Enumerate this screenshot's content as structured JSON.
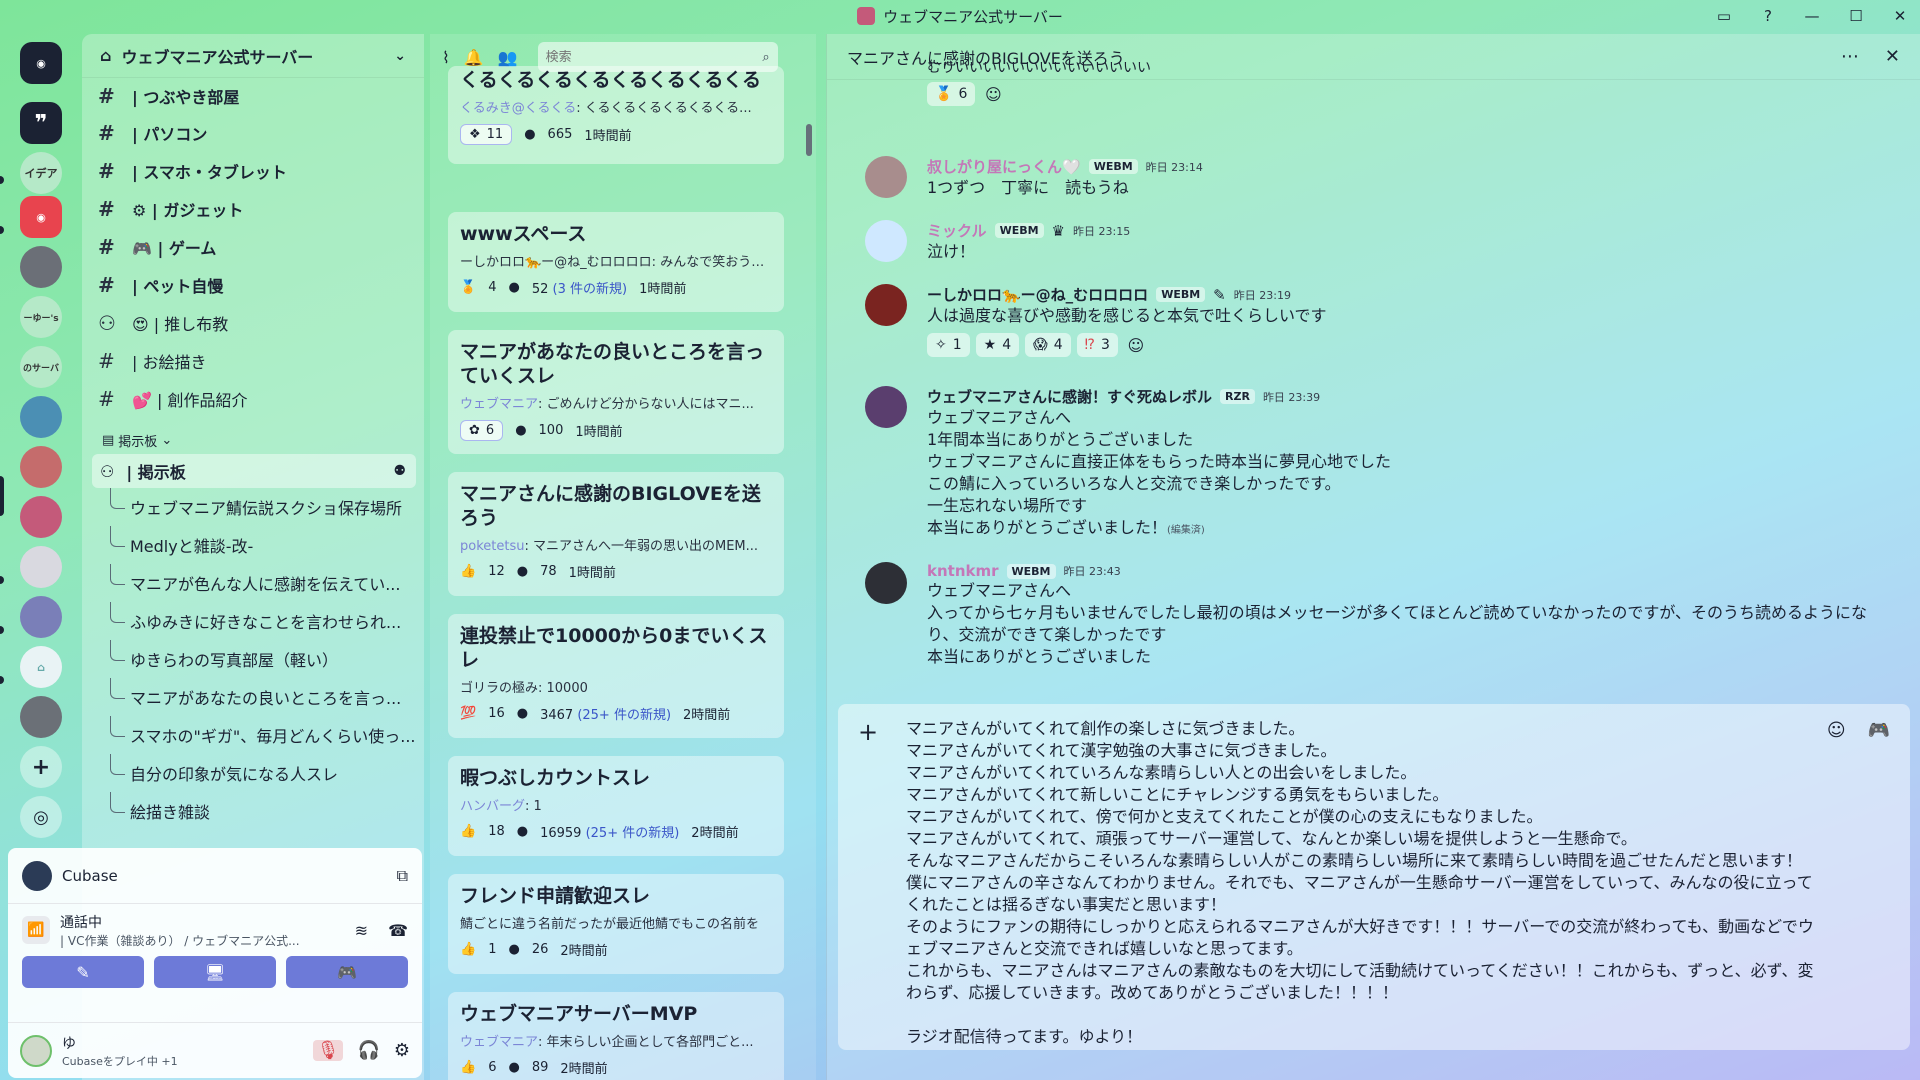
{
  "window": {
    "title": "ウェブマニア公式サーバー"
  },
  "server": {
    "name": "ウェブマニア公式サーバー"
  },
  "rail": {
    "labels": [
      "イデア",
      "ーゆー's",
      "のサーバ"
    ]
  },
  "channels": [
    {
      "label": "| つぶやき部屋",
      "color": "#f0a24a"
    },
    {
      "label": "| パソコン",
      "color": "#5aa6e8"
    },
    {
      "label": "| スマホ・タブレット",
      "color": "#555"
    },
    {
      "label": "⚙ | ガジェット",
      "color": ""
    },
    {
      "label": "🎮 | ゲーム",
      "color": ""
    },
    {
      "label": "| ペット自慢",
      "color": "#d9a45a"
    },
    {
      "label": "😍 | 推し布教",
      "color": ""
    },
    {
      "label": "| お絵描き",
      "color": "#f2a9c4"
    },
    {
      "label": "💕 | 創作品紹介",
      "color": ""
    }
  ],
  "category": {
    "label": "掲示板"
  },
  "forum_channel": {
    "label": "| 掲示板"
  },
  "threads": [
    "ウェブマニア鯖伝説スクショ保存場所",
    "Medlyと雑談-改-",
    "マニアが色んな人に感謝を伝えてい...",
    "ふゆみきに好きなことを言わせられ...",
    "ゆきらわの写真部屋（軽い）",
    "マニアがあなたの良いところを言っ...",
    "スマホの\"ギガ\"、毎月どんくらい使っ...",
    "自分の印象が気になる人スレ",
    "絵描き雑談"
  ],
  "voice": {
    "activity": "Cubase",
    "status": "通話中",
    "channel": "| VC作業（雑談あり） / ウェブマニア公式...",
    "btn1": "✎",
    "btn2": "🖥",
    "btn3": "🎮"
  },
  "user": {
    "name": "ゆ",
    "status": "Cubaseをプレイ中 +1"
  },
  "forum_list": {
    "search_placeholder": "検索",
    "posts": [
      {
        "title": "くるくるくるくるくるくるくるくる",
        "author": "くるみき@くるくる",
        "preview": ": くるくるくるくるくるくる...",
        "react_count": "11",
        "replies": "665",
        "new": "",
        "time": "1時間前"
      },
      {
        "title": "wwwスペース",
        "author": "",
        "preview": "ーしかロロ🐆ー@ね_むロロロロ: みんなで笑おう！...",
        "react_count": "4",
        "replies": "52",
        "new": "(3 件の新規)",
        "time": "1時間前"
      },
      {
        "title": "マニアがあなたの良いところを言っていくスレ",
        "author": "ウェブマニア",
        "preview": ": ごめんけど分からない人にはマニ...",
        "react_count": "6",
        "replies": "100",
        "new": "",
        "time": "1時間前"
      },
      {
        "title": "マニアさんに感謝のBIGLOVEを送ろう",
        "author": "poketetsu",
        "preview": ": マニアさんへ一年弱の思い出のMEM...",
        "react_count": "12",
        "replies": "78",
        "new": "",
        "time": "1時間前"
      },
      {
        "title": "連投禁止で10000から0までいくスレ",
        "author": "",
        "preview": "ゴリラの極み: 10000",
        "react_count": "16",
        "replies": "3467",
        "new": "(25+ 件の新規)",
        "time": "2時間前"
      },
      {
        "title": "暇つぶしカウントスレ",
        "author": "ハンバーグ",
        "preview": ": 1",
        "react_count": "18",
        "replies": "16959",
        "new": "(25+ 件の新規)",
        "time": "2時間前"
      },
      {
        "title": "フレンド申請歓迎スレ",
        "author": "",
        "preview": "鯖ごとに違う名前だったが最近他鯖でもこの名前を",
        "react_count": "1",
        "replies": "26",
        "new": "",
        "time": "2時間前"
      },
      {
        "title": "ウェブマニアサーバーMVP",
        "author": "ウェブマニア",
        "preview": ": 年末らしい企画として各部門ごと...",
        "react_count": "6",
        "replies": "89",
        "new": "",
        "time": "2時間前"
      }
    ]
  },
  "thread_panel": {
    "title": "マニアさんに感謝のBIGLOVEを送ろう",
    "top_partial": "むりいいいいいいいいいいいいいい",
    "top_react_count": "6",
    "messages": [
      {
        "name": "叔しがり屋にっくん🤍",
        "tag": "WEBM",
        "time": "昨日 23:14",
        "lines": [
          "1つずつ　丁寧に　読もうね"
        ]
      },
      {
        "name": "ミックル",
        "tag": "WEBM",
        "time": "昨日 23:15",
        "lines": [
          "泣け！"
        ]
      },
      {
        "name": "ーしかロロ🐆ー@ね_むロロロロ",
        "tag": "WEBM",
        "time": "昨日 23:19",
        "lines": [
          "人は過度な喜びや感動を感じると本気で吐くらしいです"
        ],
        "reactions": [
          "1",
          "4",
          "4",
          "3"
        ]
      },
      {
        "name": "ウェブマニアさんに感謝！すぐ死ぬレボル",
        "tag": "RZR",
        "time": "昨日 23:39",
        "lines": [
          "ウェブマニアさんへ",
          "1年間本当にありがとうございました",
          "ウェブマニアさんに直接正体をもらった時本当に夢見心地でした",
          "この鯖に入っていろいろな人と交流でき楽しかったです。",
          "一生忘れない場所です",
          "本当にありがとうございました！"
        ],
        "edited": "(編集済)"
      },
      {
        "name": "kntnkmr",
        "tag": "WEBM",
        "time": "昨日 23:43",
        "lines": [
          "ウェブマニアさんへ",
          "入ってから七ヶ月もいませんでしたし最初の頃はメッセージが多くてほとんど読めていなかったのですが、そのうち読めるようにな",
          "り、交流ができて楽しかったです",
          "本当にありがとうございました"
        ]
      }
    ]
  },
  "composer": {
    "text": "マニアさんがいてくれて創作の楽しさに気づきました。\nマニアさんがいてくれて漢字勉強の大事さに気づきました。\nマニアさんがいてくれていろんな素晴らしい人との出会いをしました。\nマニアさんがいてくれて新しいことにチャレンジする勇気をもらいました。\nマニアさんがいてくれて、傍で何かと支えてくれたことが僕の心の支えにもなりました。\nマニアさんがいてくれて、頑張ってサーバー運営して、なんとか楽しい場を提供しようと一生懸命で。\nそんなマニアさんだからこそいろんな素晴らしい人がこの素晴らしい場所に来て素晴らしい時間を過ごせたんだと思います！\n僕にマニアさんの辛さなんてわかりません。それでも、マニアさんが一生懸命サーバー運営をしていって、みんなの役に立って\nくれたことは揺るぎない事実だと思います！\nそのようにファンの期待にしっかりと応えられるマニアさんが大好きです！！！サーバーでの交流が終わっても、動画などでウ\nェブマニアさんと交流できれば嬉しいなと思ってます。\nこれからも、マニアさんはマニアさんの素敵なものを大切にして活動続けていってください！！これからも、ずっと、必ず、変\nわらず、応援していきます。改めてありがとうございました！！！！\n\nラジオ配信待ってます。ゆより！"
  }
}
